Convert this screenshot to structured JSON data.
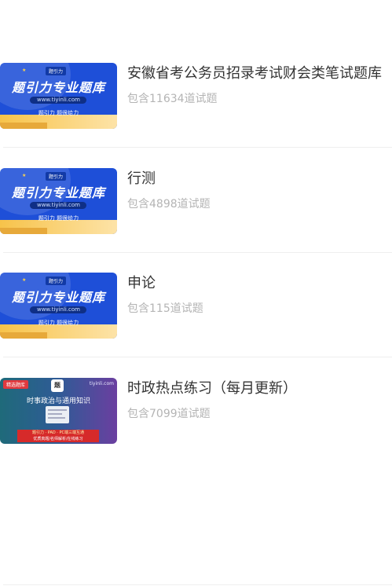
{
  "items": [
    {
      "title": "安徽省考公务员招录考试财会类笔试题库",
      "subtitle": "包含11634道试题",
      "thumb": {
        "logo": "题引力",
        "headline": "题引力专业题库",
        "url": "www.tiyinli.com",
        "tagline": "题引力 题很给力"
      }
    },
    {
      "title": "行测",
      "subtitle": "包含4898道试题",
      "thumb": {
        "logo": "题引力",
        "headline": "题引力专业题库",
        "url": "www.tiyinli.com",
        "tagline": "题引力 题很给力"
      }
    },
    {
      "title": "申论",
      "subtitle": "包含115道试题",
      "thumb": {
        "logo": "题引力",
        "headline": "题引力专业题库",
        "url": "www.tiyinli.com",
        "tagline": "题引力 题很给力"
      }
    },
    {
      "title": "时政热点练习（每月更新）",
      "subtitle": "包含7099道试题",
      "thumb": {
        "badge": "精选题库",
        "logo": "题",
        "site": "tiyinli.com",
        "headline": "时事政治与通用知识",
        "line1": "题引力 · PAD · PC端三端互通",
        "line2": "优质真题/名师解析/在线练习"
      }
    }
  ],
  "colors": {
    "banner_blue": "#1e4fd8",
    "banner_gold": "#f7c34a",
    "title": "#333333",
    "subtitle": "#b4b4b4",
    "divider": "#eeeeee"
  }
}
